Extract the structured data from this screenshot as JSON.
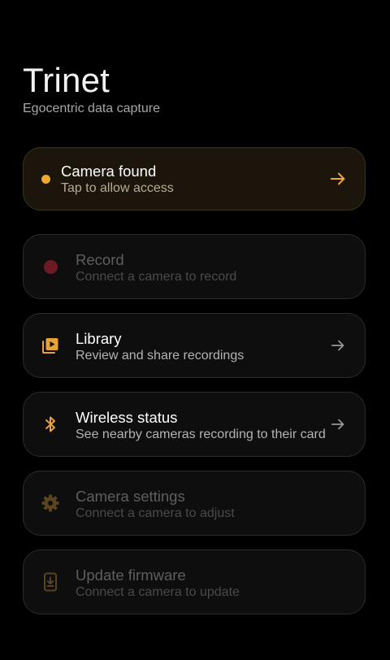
{
  "app": {
    "title": "Trinet",
    "subtitle": "Egocentric data capture"
  },
  "colors": {
    "background": "#000000",
    "accent": "#f0a830",
    "record_dot": "#6e1a24",
    "found_card_bg": "#1b150b"
  },
  "cards": {
    "camera_found": {
      "label": "Camera found",
      "description": "Tap to allow access",
      "icon": "status-dot-icon",
      "enabled": true
    },
    "record": {
      "label": "Record",
      "description": "Connect a camera to record",
      "icon": "record-icon",
      "enabled": false
    },
    "library": {
      "label": "Library",
      "description": "Review and share recordings",
      "icon": "video-library-icon",
      "enabled": true
    },
    "wireless_status": {
      "label": "Wireless status",
      "description": "See nearby cameras recording to their card",
      "icon": "bluetooth-icon",
      "enabled": true
    },
    "camera_settings": {
      "label": "Camera settings",
      "description": "Connect a camera to adjust",
      "icon": "gear-icon",
      "enabled": false
    },
    "update_firmware": {
      "label": "Update firmware",
      "description": "Connect a camera to update",
      "icon": "firmware-update-icon",
      "enabled": false
    }
  }
}
